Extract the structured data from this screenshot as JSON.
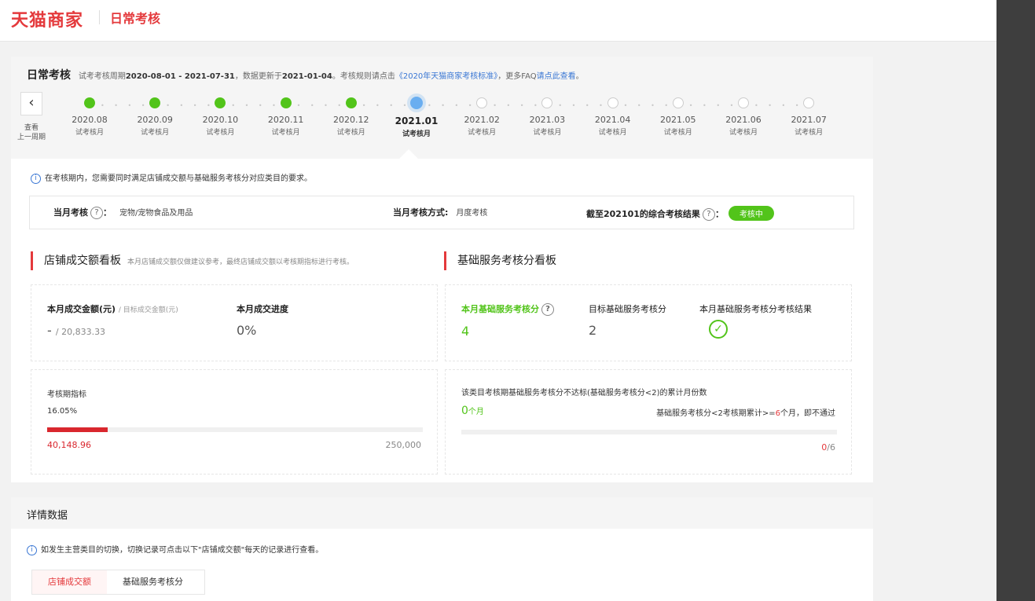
{
  "header": {
    "logo": "天猫商家",
    "subtitle": "日常考核"
  },
  "exam": {
    "title": "日常考核",
    "desc_prefix": "试考考核周期",
    "period": "2020-08-01 - 2021-07-31",
    "desc_mid": "，数据更新于",
    "update_date": "2021-01-04",
    "desc_rule": "。考核规则请点击",
    "rule_link": "《2020年天猫商家考核标准》",
    "desc_more": "，更多FAQ",
    "faq_link": "请点此查看",
    "desc_end": "。"
  },
  "timeline": {
    "prev_label": "查看\n上一周期",
    "months": [
      {
        "m": "2020.08",
        "s": "试考核月",
        "state": "done"
      },
      {
        "m": "2020.09",
        "s": "试考核月",
        "state": "done"
      },
      {
        "m": "2020.10",
        "s": "试考核月",
        "state": "done"
      },
      {
        "m": "2020.11",
        "s": "试考核月",
        "state": "done"
      },
      {
        "m": "2020.12",
        "s": "试考核月",
        "state": "done"
      },
      {
        "m": "2021.01",
        "s": "试考核月",
        "state": "current"
      },
      {
        "m": "2021.02",
        "s": "试考核月",
        "state": "future"
      },
      {
        "m": "2021.03",
        "s": "试考核月",
        "state": "future"
      },
      {
        "m": "2021.04",
        "s": "试考核月",
        "state": "future"
      },
      {
        "m": "2021.05",
        "s": "试考核月",
        "state": "future"
      },
      {
        "m": "2021.06",
        "s": "试考核月",
        "state": "future"
      },
      {
        "m": "2021.07",
        "s": "试考核月",
        "state": "future"
      }
    ]
  },
  "notice": "在考核期内，您需要同时满足店铺成交额与基础服务考核分对应类目的要求。",
  "summary": {
    "month_exam_label": "当月考核",
    "month_exam_value": "宠物/宠物食品及用品",
    "method_label": "当月考核方式:",
    "method_value": "月度考核",
    "result_label": "截至202101的综合考核结果",
    "result_badge": "考核中"
  },
  "sales": {
    "title": "店铺成交额看板",
    "desc": "本月店铺成交额仅做建议参考，最终店铺成交额以考核期指标进行考核。",
    "amount_label": "本月成交金额(元)",
    "amount_target_label": "/ 目标成交金额(元)",
    "amount_value": "-",
    "amount_target": "/ 20,833.33",
    "progress_label": "本月成交进度",
    "progress_value": "0%",
    "period_label": "考核期指标",
    "period_percent": "16.05%",
    "period_progress": 0.1605,
    "period_current": "40,148.96",
    "period_target": "250,000"
  },
  "service": {
    "title": "基础服务考核分看板",
    "score_label": "本月基础服务考核分",
    "score_value": "4",
    "target_label": "目标基础服务考核分",
    "target_value": "2",
    "result_label": "本月基础服务考核分考核结果",
    "fail_title": "该类目考核期基础服务考核分不达标(基础服务考核分<2)的累计月份数",
    "fail_count": "0",
    "fail_unit": "个月",
    "rule_prefix": "基础服务考核分<2考核期累计>=",
    "rule_num": "6",
    "rule_suffix": "个月，即不通过",
    "ratio_num": "0",
    "ratio_den": "/6",
    "fail_progress": 0
  },
  "detail": {
    "title": "详情数据",
    "notice": "如发生主营类目的切换，切换记录可点击以下\"店铺成交额\"每天的记录进行查看。",
    "tabs": [
      "店铺成交额",
      "基础服务考核分"
    ]
  },
  "colors": {
    "brand": "#e4393c",
    "success": "#52c41a",
    "link": "#3a77d4",
    "current": "#6aaef0"
  }
}
